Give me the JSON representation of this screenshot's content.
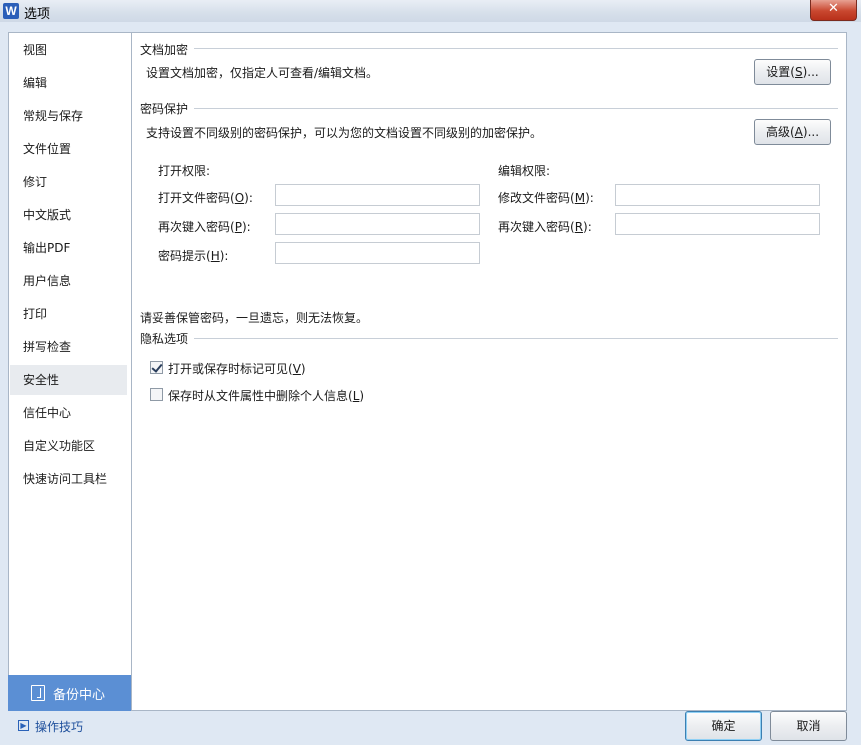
{
  "window": {
    "title": "选项",
    "logo": "W",
    "close": "✕"
  },
  "sidebar": {
    "items": [
      {
        "label": "视图"
      },
      {
        "label": "编辑"
      },
      {
        "label": "常规与保存"
      },
      {
        "label": "文件位置"
      },
      {
        "label": "修订"
      },
      {
        "label": "中文版式"
      },
      {
        "label": "输出PDF"
      },
      {
        "label": "用户信息"
      },
      {
        "label": "打印"
      },
      {
        "label": "拼写检查"
      },
      {
        "label": "安全性",
        "active": true
      },
      {
        "label": "信任中心"
      },
      {
        "label": "自定义功能区"
      },
      {
        "label": "快速访问工具栏"
      }
    ],
    "backup": {
      "label": "备份中心",
      "icon": "backup-icon"
    },
    "tips": {
      "label": "操作技巧",
      "icon": "play-square-icon"
    }
  },
  "encryption": {
    "title": "文档加密",
    "description": "设置文档加密，仅指定人可查看/编辑文档。",
    "button": {
      "label": "设置",
      "key": "S",
      "suffix": "..."
    }
  },
  "password": {
    "title": "密码保护",
    "description": "支持设置不同级别的密码保护，可以为您的文档设置不同级别的加密保护。",
    "button": {
      "label": "高级",
      "key": "A",
      "suffix": "..."
    },
    "open": {
      "heading": "打开权限:",
      "open_label": "打开文件密码",
      "open_key": "O",
      "open_value": "",
      "reenter_label": "再次键入密码",
      "reenter_key": "P",
      "reenter_value": "",
      "hint_label": "密码提示",
      "hint_key": "H",
      "hint_value": ""
    },
    "edit": {
      "heading": "编辑权限:",
      "modify_label": "修改文件密码",
      "modify_key": "M",
      "modify_value": "",
      "reenter_label": "再次键入密码",
      "reenter_key": "R",
      "reenter_value": ""
    },
    "warning": "请妥善保管密码，一旦遗忘，则无法恢复。"
  },
  "privacy": {
    "title": "隐私选项",
    "opt1": {
      "label": "打开或保存时标记可见",
      "key": "V",
      "checked": true
    },
    "opt2": {
      "label": "保存时从文件属性中删除个人信息",
      "key": "L",
      "checked": false
    }
  },
  "footer": {
    "ok": "确定",
    "cancel": "取消"
  }
}
